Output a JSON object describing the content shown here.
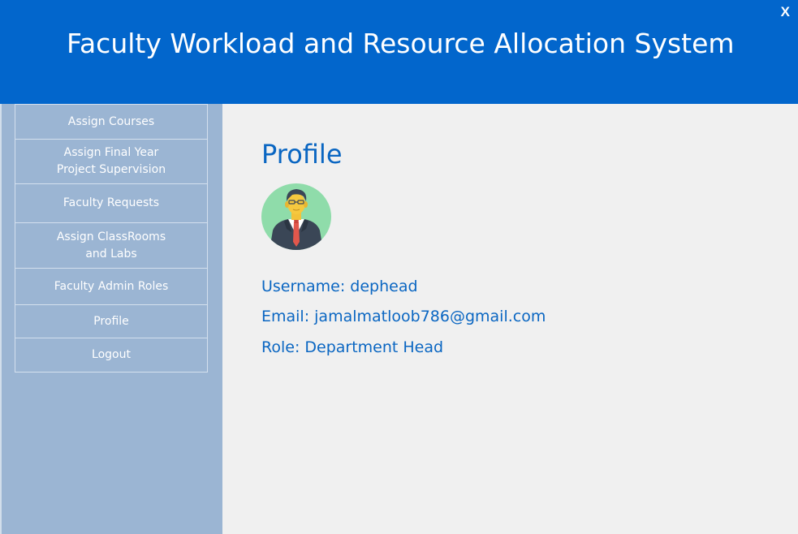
{
  "header": {
    "title": "Faculty Workload and Resource Allocation System",
    "close_label": "X"
  },
  "sidebar": {
    "items": [
      {
        "label": "Assign Courses"
      },
      {
        "label": "Assign Final Year\nProject Supervision"
      },
      {
        "label": "Faculty Requests"
      },
      {
        "label": "Assign ClassRooms\nand Labs"
      },
      {
        "label": "Faculty Admin Roles"
      },
      {
        "label": "Profile"
      },
      {
        "label": "Logout"
      }
    ]
  },
  "main": {
    "title": "Profile",
    "avatar_icon": "user-avatar-icon",
    "username": "Username: dephead",
    "email": "Email: jamalmatloob786@gmail.com",
    "role": "Role: Department Head"
  },
  "colors": {
    "header_bg": "#0266cc",
    "sidebar_bg": "#9bb5d3",
    "main_bg": "#f0f0f0",
    "accent_text": "#0a66c2"
  }
}
